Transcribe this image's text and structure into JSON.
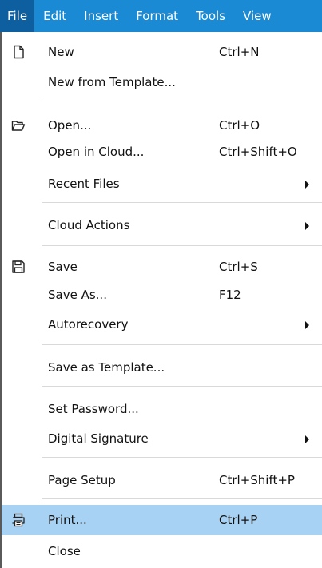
{
  "menubar": {
    "items": [
      {
        "label": "File"
      },
      {
        "label": "Edit"
      },
      {
        "label": "Insert"
      },
      {
        "label": "Format"
      },
      {
        "label": "Tools"
      },
      {
        "label": "View"
      }
    ]
  },
  "colors": {
    "menubar_bg": "#1a8ad4",
    "active_menu_bg": "#0e5f9f",
    "highlight_bg": "#a8d2f3"
  },
  "file_menu": {
    "items": [
      {
        "label": "New",
        "shortcut": "Ctrl+N",
        "icon": "new-document-icon"
      },
      {
        "label": "New from Template..."
      },
      {
        "label": "Open...",
        "shortcut": "Ctrl+O",
        "icon": "folder-open-icon"
      },
      {
        "label": "Open in Cloud...",
        "shortcut": "Ctrl+Shift+O"
      },
      {
        "label": "Recent Files",
        "submenu": true
      },
      {
        "label": "Cloud Actions",
        "submenu": true
      },
      {
        "label": "Save",
        "shortcut": "Ctrl+S",
        "icon": "save-icon"
      },
      {
        "label": "Save As...",
        "shortcut": "F12"
      },
      {
        "label": "Autorecovery",
        "submenu": true
      },
      {
        "label": "Save as Template..."
      },
      {
        "label": "Set Password..."
      },
      {
        "label": "Digital Signature",
        "submenu": true
      },
      {
        "label": "Page Setup",
        "shortcut": "Ctrl+Shift+P"
      },
      {
        "label": "Print...",
        "shortcut": "Ctrl+P",
        "icon": "printer-icon",
        "highlighted": true
      },
      {
        "label": "Close"
      }
    ]
  }
}
